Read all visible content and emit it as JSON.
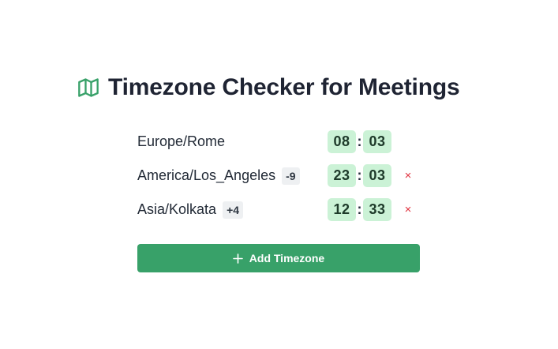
{
  "header": {
    "icon": "map-icon",
    "title": "Timezone Checker for Meetings",
    "accent_color": "#38a169"
  },
  "timezones": [
    {
      "name": "Europe/Rome",
      "offset": "",
      "hours": "08",
      "minutes": "03",
      "removable": false
    },
    {
      "name": "America/Los_Angeles",
      "offset": "-9",
      "hours": "23",
      "minutes": "03",
      "removable": true
    },
    {
      "name": "Asia/Kolkata",
      "offset": "+4",
      "hours": "12",
      "minutes": "33",
      "removable": true
    }
  ],
  "time_separator": ":",
  "remove_symbol": "×",
  "add_button": {
    "icon": "plus-icon",
    "label": "Add Timezone",
    "color": "#38a169"
  }
}
